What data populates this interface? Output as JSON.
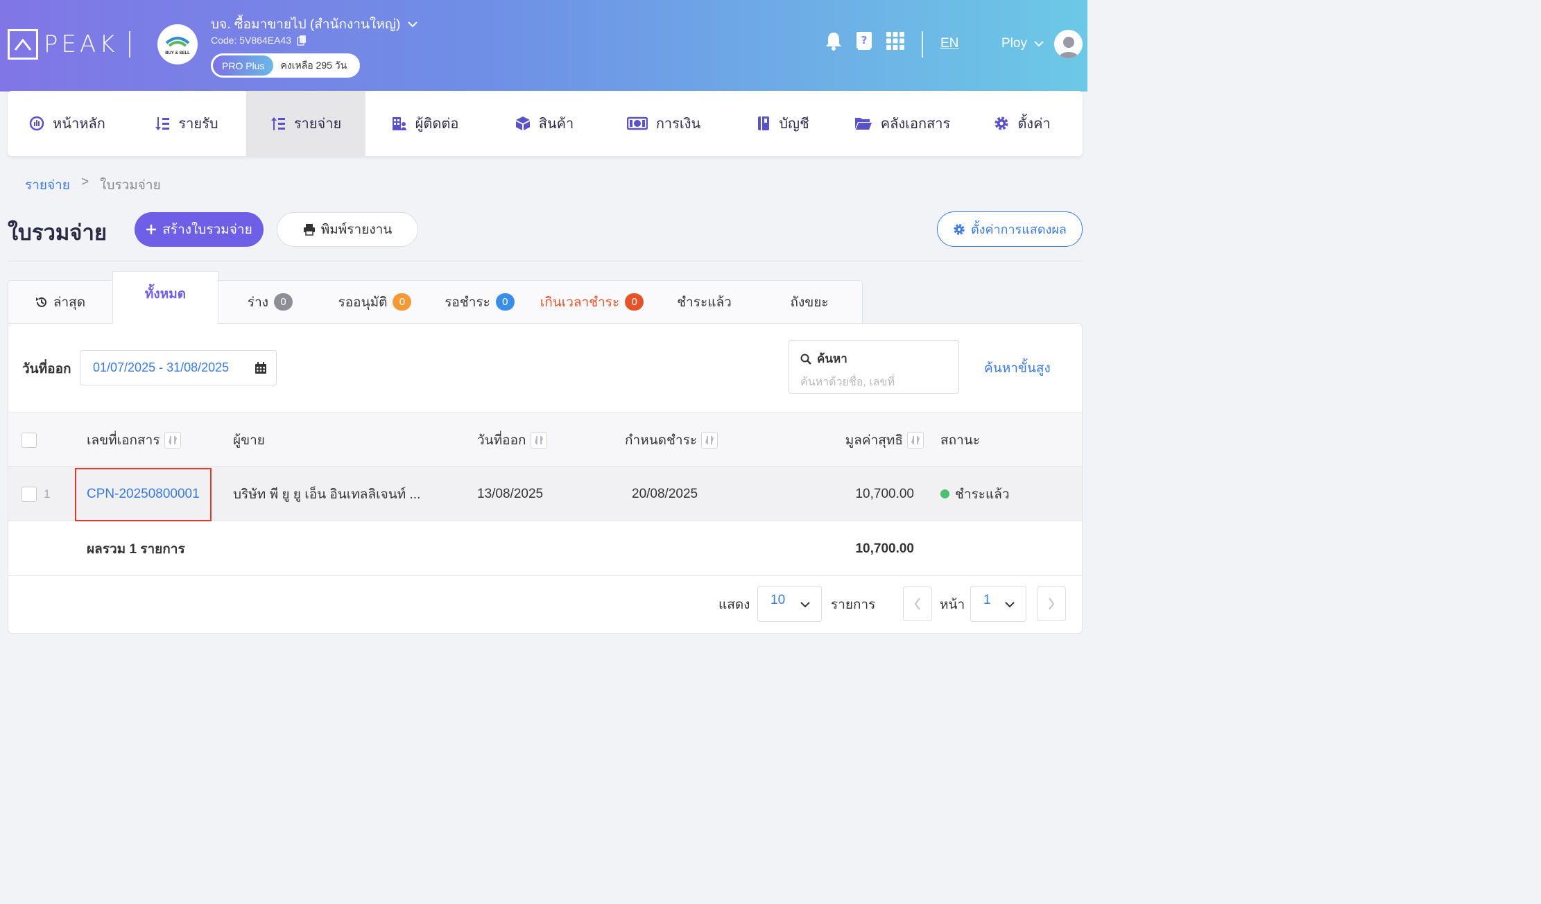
{
  "header": {
    "logo_text": "PEAK",
    "company_name": "บจ. ซื้อมาขายไป (สำนักงานใหญ่)",
    "company_code": "Code: 5V864EA43",
    "company_seal_text": "BUY & SELL",
    "plan": "PRO Plus",
    "plan_remaining": "คงเหลือ 295 วัน",
    "language": "EN",
    "user_name": "Ploy"
  },
  "nav": [
    {
      "label": "หน้าหลัก",
      "icon": "dashboard-icon"
    },
    {
      "label": "รายรับ",
      "icon": "income-icon"
    },
    {
      "label": "รายจ่าย",
      "icon": "expense-icon",
      "active": true
    },
    {
      "label": "ผู้ติดต่อ",
      "icon": "contacts-icon"
    },
    {
      "label": "สินค้า",
      "icon": "product-box-icon"
    },
    {
      "label": "การเงิน",
      "icon": "money-icon"
    },
    {
      "label": "บัญชี",
      "icon": "ledger-book-icon"
    },
    {
      "label": "คลังเอกสาร",
      "icon": "folder-icon"
    },
    {
      "label": "ตั้งค่า",
      "icon": "gear-icon"
    }
  ],
  "breadcrumb": {
    "parent": "รายจ่าย",
    "separator": ">",
    "current": "ใบรวมจ่าย"
  },
  "page": {
    "title": "ใบรวมจ่าย",
    "create_button": "สร้างใบรวมจ่าย",
    "print_button": "พิมพ์รายงาน",
    "display_settings_button": "ตั้งค่าการแสดงผล"
  },
  "tabs": [
    {
      "label": "ล่าสุด",
      "icon": "history-icon"
    },
    {
      "label": "ทั้งหมด",
      "active": true
    },
    {
      "label": "ร่าง",
      "count": "0",
      "count_color": "#8e8e96"
    },
    {
      "label": "รออนุมัติ",
      "count": "0",
      "count_color": "#f29a38"
    },
    {
      "label": "รอชำระ",
      "count": "0",
      "count_color": "#3a8ee6"
    },
    {
      "label": "เกินเวลาชำระ",
      "count": "0",
      "count_color": "#e5532b",
      "danger": true
    },
    {
      "label": "ชำระแล้ว"
    },
    {
      "label": "ถังขยะ"
    }
  ],
  "filter": {
    "date_label": "วันที่ออก",
    "date_range": "01/07/2025 - 31/08/2025",
    "search_label": "ค้นหา",
    "search_placeholder": "ค้นหาด้วยชื่อ, เลขที่",
    "advanced_search": "ค้นหาขั้นสูง"
  },
  "table": {
    "columns": [
      "เลขที่เอกสาร",
      "ผู้ขาย",
      "วันที่ออก",
      "กำหนดชำระ",
      "มูลค่าสุทธิ",
      "สถานะ"
    ],
    "rows": [
      {
        "index": "1",
        "doc_no": "CPN-20250800001",
        "vendor": "บริษัท พี ยู ยู เอ็น อินเทลลิเจนท์ ...",
        "issue_date": "13/08/2025",
        "due_date": "20/08/2025",
        "amount": "10,700.00",
        "status": "ชำระแล้ว",
        "status_color": "#4cbf72"
      }
    ],
    "footer_label": "ผลรวม 1 รายการ",
    "footer_total": "10,700.00"
  },
  "pagination": {
    "show_label": "แสดง",
    "page_size": "10",
    "items_label": "รายการ",
    "page_label": "หน้า",
    "page": "1"
  },
  "colors": {
    "primary": "#6e5fe6",
    "link": "#3a7ae0",
    "highlight_box": "#e0392b"
  }
}
